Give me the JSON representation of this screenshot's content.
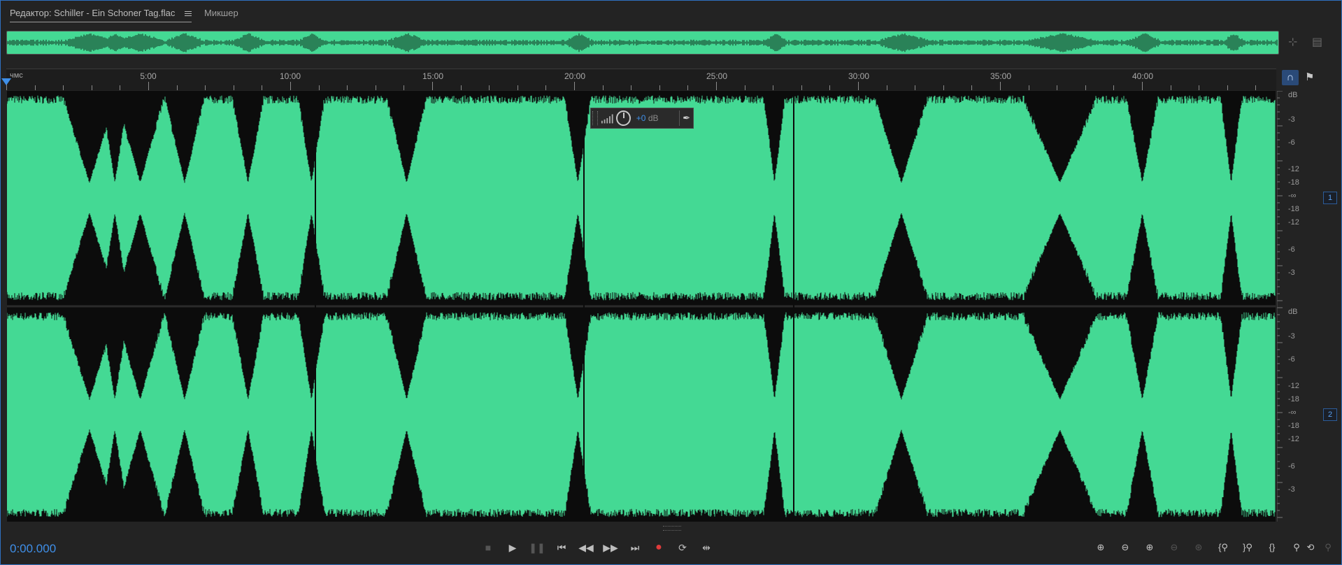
{
  "tabs": [
    {
      "label": "Редактор: Schiller - Ein Schoner Tag.flac",
      "active": true
    },
    {
      "label": "Микшер",
      "active": false
    }
  ],
  "ruler": {
    "unit": "чмс",
    "labels": [
      "5:00",
      "10:00",
      "15:00",
      "20:00",
      "25:00",
      "30:00",
      "35:00",
      "40:00"
    ]
  },
  "channels": [
    {
      "number": "1",
      "db_unit": "dB",
      "db_labels": [
        "-3",
        "-6",
        "-12",
        "-18",
        "-∞",
        "-18",
        "-12",
        "-6",
        "-3"
      ]
    },
    {
      "number": "2",
      "db_unit": "dB",
      "db_labels": [
        "-3",
        "-6",
        "-12",
        "-18",
        "-∞",
        "-18",
        "-12",
        "-6",
        "-3"
      ]
    }
  ],
  "hud": {
    "value": "+0",
    "unit": "dB"
  },
  "transport": {
    "timecode": "0:00.000",
    "buttons": [
      "stop-icon",
      "play-icon",
      "pause-icon",
      "skip-start-icon",
      "rewind-icon",
      "fast-forward-icon",
      "skip-end-icon",
      "record-icon",
      "loop-icon",
      "skip-selection-icon"
    ]
  },
  "zoom": {
    "buttons": [
      "zoom-in-amplitude-icon",
      "zoom-out-amplitude-icon",
      "zoom-in-time-icon",
      "zoom-out-time-icon",
      "zoom-out-full-icon",
      "zoom-in-point-icon",
      "zoom-to-selection-start-icon",
      "zoom-to-selection-end-icon",
      "zoom-to-selection-icon",
      "zoom-reset-icon",
      "zoom-to-track-icon"
    ]
  },
  "colors": {
    "waveform": "#44d994",
    "accent": "#3f8fe8",
    "record": "#e03b3b",
    "background": "#232323"
  }
}
